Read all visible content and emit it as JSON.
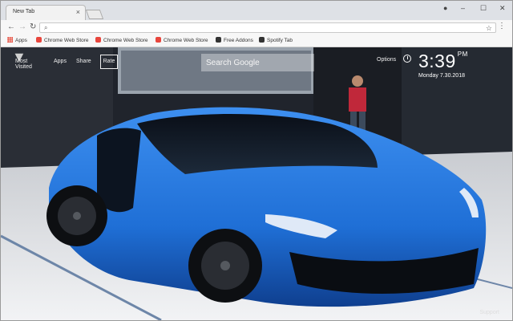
{
  "browser": {
    "tab_title": "New Tab",
    "tab_close_glyph": "×",
    "window_controls": [
      "–",
      "☐",
      "✕"
    ],
    "nav": {
      "back": "←",
      "forward": "→",
      "reload": "↻"
    },
    "omnibox_value": "",
    "bookmarks": [
      {
        "label": "Apps",
        "icon": "apps-grid-icon"
      },
      {
        "label": "Chrome Web Store",
        "icon": "chrome-web-store-icon"
      },
      {
        "label": "Chrome Web Store",
        "icon": "chrome-web-store-icon"
      },
      {
        "label": "Chrome Web Store",
        "icon": "chrome-web-store-icon"
      },
      {
        "label": "Free Addons",
        "icon": "free-addons-icon"
      },
      {
        "label": "Spotify Tab",
        "icon": "spotify-tab-icon"
      }
    ]
  },
  "newtab": {
    "nav": {
      "most_visited": "Most Visited",
      "apps": "Apps",
      "share": "Share",
      "rate": "Rate"
    },
    "search_placeholder": "Search Google",
    "options_label": "Options",
    "time": "3:39",
    "ampm": "PM",
    "date": "Monday  7.30.2018",
    "support_label": "Support"
  },
  "colors": {
    "car_blue": "#1f6fd6",
    "tab_strip": "#dee1e6",
    "toolbar": "#f7f7f7"
  }
}
